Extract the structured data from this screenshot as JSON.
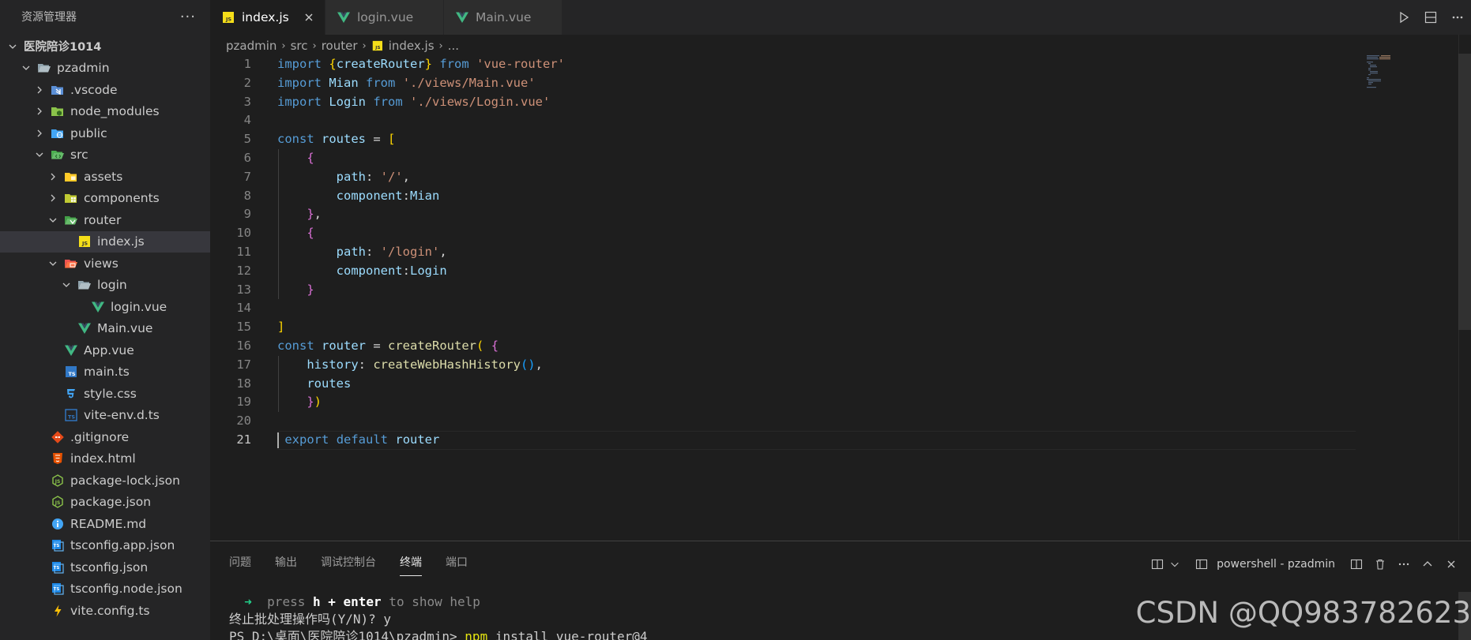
{
  "sidebar": {
    "title": "资源管理器",
    "more_glyph": "···",
    "tree": [
      {
        "label": "医院陪诊1014",
        "icon": "none",
        "chevron": "down",
        "indent": 0,
        "root": true
      },
      {
        "label": "pzadmin",
        "icon": "folder-open",
        "chevron": "down",
        "indent": 1
      },
      {
        "label": ".vscode",
        "icon": "vscode-folder",
        "chevron": "right",
        "indent": 2
      },
      {
        "label": "node_modules",
        "icon": "node-folder",
        "chevron": "right",
        "indent": 2
      },
      {
        "label": "public",
        "icon": "public-folder",
        "chevron": "right",
        "indent": 2
      },
      {
        "label": "src",
        "icon": "src-folder",
        "chevron": "down",
        "indent": 2
      },
      {
        "label": "assets",
        "icon": "assets-folder",
        "chevron": "right",
        "indent": 3
      },
      {
        "label": "components",
        "icon": "components-folder",
        "chevron": "right",
        "indent": 3
      },
      {
        "label": "router",
        "icon": "router-folder",
        "chevron": "down",
        "indent": 3
      },
      {
        "label": "index.js",
        "icon": "js-file",
        "chevron": "none",
        "indent": 4,
        "selected": true
      },
      {
        "label": "views",
        "icon": "views-folder",
        "chevron": "down",
        "indent": 3
      },
      {
        "label": "login",
        "icon": "folder-open",
        "chevron": "down",
        "indent": 4
      },
      {
        "label": "login.vue",
        "icon": "vue-file",
        "chevron": "none",
        "indent": 5
      },
      {
        "label": "Main.vue",
        "icon": "vue-file",
        "chevron": "none",
        "indent": 4
      },
      {
        "label": "App.vue",
        "icon": "vue-file",
        "chevron": "none",
        "indent": 3
      },
      {
        "label": "main.ts",
        "icon": "ts-file",
        "chevron": "none",
        "indent": 3
      },
      {
        "label": "style.css",
        "icon": "css-file",
        "chevron": "none",
        "indent": 3
      },
      {
        "label": "vite-env.d.ts",
        "icon": "dts-file",
        "chevron": "none",
        "indent": 3
      },
      {
        "label": ".gitignore",
        "icon": "git-file",
        "chevron": "none",
        "indent": 2
      },
      {
        "label": "index.html",
        "icon": "html-file",
        "chevron": "none",
        "indent": 2
      },
      {
        "label": "package-lock.json",
        "icon": "node-json-file",
        "chevron": "none",
        "indent": 2
      },
      {
        "label": "package.json",
        "icon": "node-json-file",
        "chevron": "none",
        "indent": 2
      },
      {
        "label": "README.md",
        "icon": "info-file",
        "chevron": "none",
        "indent": 2
      },
      {
        "label": "tsconfig.app.json",
        "icon": "tsconfig-file",
        "chevron": "none",
        "indent": 2
      },
      {
        "label": "tsconfig.json",
        "icon": "tsconfig-file",
        "chevron": "none",
        "indent": 2
      },
      {
        "label": "tsconfig.node.json",
        "icon": "tsconfig-file",
        "chevron": "none",
        "indent": 2
      },
      {
        "label": "vite.config.ts",
        "icon": "vite-file",
        "chevron": "none",
        "indent": 2
      }
    ]
  },
  "tabs": [
    {
      "label": "index.js",
      "icon": "js-file",
      "active": true,
      "close": true
    },
    {
      "label": "login.vue",
      "icon": "vue-file",
      "active": false
    },
    {
      "label": "Main.vue",
      "icon": "vue-file",
      "active": false
    }
  ],
  "breadcrumb": [
    "pzadmin",
    "src",
    "router",
    "index.js",
    "..."
  ],
  "editor": {
    "active_line": 21,
    "lines": [
      [
        [
          "import",
          "imp"
        ],
        [
          " ",
          "plain"
        ],
        [
          "{",
          "b1"
        ],
        [
          "createRouter",
          "var"
        ],
        [
          "}",
          "b1"
        ],
        [
          " ",
          "plain"
        ],
        [
          "from",
          "imp"
        ],
        [
          " ",
          "plain"
        ],
        [
          "'vue-router'",
          "str"
        ]
      ],
      [
        [
          "import",
          "imp"
        ],
        [
          " ",
          "plain"
        ],
        [
          "Mian",
          "var"
        ],
        [
          " ",
          "plain"
        ],
        [
          "from",
          "imp"
        ],
        [
          " ",
          "plain"
        ],
        [
          "'./views/Main.vue'",
          "str"
        ]
      ],
      [
        [
          "import",
          "imp"
        ],
        [
          " ",
          "plain"
        ],
        [
          "Login",
          "var"
        ],
        [
          " ",
          "plain"
        ],
        [
          "from",
          "imp"
        ],
        [
          " ",
          "plain"
        ],
        [
          "'./views/Login.vue'",
          "str"
        ]
      ],
      [],
      [
        [
          "const",
          "kw"
        ],
        [
          " ",
          "plain"
        ],
        [
          "routes",
          "var"
        ],
        [
          " = ",
          "plain"
        ],
        [
          "[",
          "b1"
        ]
      ],
      [
        [
          "    ",
          "plain"
        ],
        [
          "{",
          "b2"
        ]
      ],
      [
        [
          "        ",
          "plain"
        ],
        [
          "path",
          "var"
        ],
        [
          ": ",
          "plain"
        ],
        [
          "'/'",
          "str"
        ],
        [
          ",",
          "plain"
        ]
      ],
      [
        [
          "        ",
          "plain"
        ],
        [
          "component",
          "var"
        ],
        [
          ":",
          "plain"
        ],
        [
          "Mian",
          "var"
        ]
      ],
      [
        [
          "    ",
          "plain"
        ],
        [
          "}",
          "b2"
        ],
        [
          ",",
          "plain"
        ]
      ],
      [
        [
          "    ",
          "plain"
        ],
        [
          "{",
          "b2"
        ]
      ],
      [
        [
          "        ",
          "plain"
        ],
        [
          "path",
          "var"
        ],
        [
          ": ",
          "plain"
        ],
        [
          "'/login'",
          "str"
        ],
        [
          ",",
          "plain"
        ]
      ],
      [
        [
          "        ",
          "plain"
        ],
        [
          "component",
          "var"
        ],
        [
          ":",
          "plain"
        ],
        [
          "Login",
          "var"
        ]
      ],
      [
        [
          "    ",
          "plain"
        ],
        [
          "}",
          "b2"
        ]
      ],
      [],
      [
        [
          "]",
          "b1"
        ]
      ],
      [
        [
          "const",
          "kw"
        ],
        [
          " ",
          "plain"
        ],
        [
          "router",
          "var"
        ],
        [
          " = ",
          "plain"
        ],
        [
          "createRouter",
          "fn"
        ],
        [
          "(",
          "b1"
        ],
        [
          " ",
          "plain"
        ],
        [
          "{",
          "b2"
        ]
      ],
      [
        [
          "    ",
          "plain"
        ],
        [
          "history",
          "var"
        ],
        [
          ": ",
          "plain"
        ],
        [
          "createWebHashHistory",
          "fn"
        ],
        [
          "()",
          "b3"
        ],
        [
          ",",
          "plain"
        ]
      ],
      [
        [
          "    ",
          "plain"
        ],
        [
          "routes",
          "var"
        ]
      ],
      [
        [
          "    ",
          "plain"
        ],
        [
          "}",
          "b2"
        ],
        [
          ")",
          "b1"
        ]
      ],
      [],
      [
        [
          " ",
          "plain"
        ],
        [
          "export",
          "imp"
        ],
        [
          " ",
          "plain"
        ],
        [
          "default",
          "imp"
        ],
        [
          " ",
          "plain"
        ],
        [
          "router",
          "var"
        ]
      ]
    ]
  },
  "panel": {
    "tabs": [
      "问题",
      "输出",
      "调试控制台",
      "终端",
      "端口"
    ],
    "active_tab": 3,
    "terminal_name": "powershell - pzadmin",
    "terminal_lines": [
      [
        [
          "  ➜  ",
          "arrow"
        ],
        [
          "press ",
          "dim"
        ],
        [
          "h + enter",
          "bold"
        ],
        [
          " to show help",
          "dim"
        ]
      ],
      [
        [
          "终止批处理操作吗(Y/N)? y",
          "plain"
        ]
      ],
      [
        [
          "PS D:\\桌面\\医院陪诊1014\\pzadmin> ",
          "plain"
        ],
        [
          "npm",
          "cmd"
        ],
        [
          " install vue-router@4",
          "plain"
        ]
      ]
    ]
  },
  "watermark": "CSDN @QQ983782623",
  "colors": {
    "js_icon": "#f5de19",
    "vue_icon": "#41b883",
    "ts_icon": "#3178c6",
    "accent_folder": "#dcb67a"
  }
}
